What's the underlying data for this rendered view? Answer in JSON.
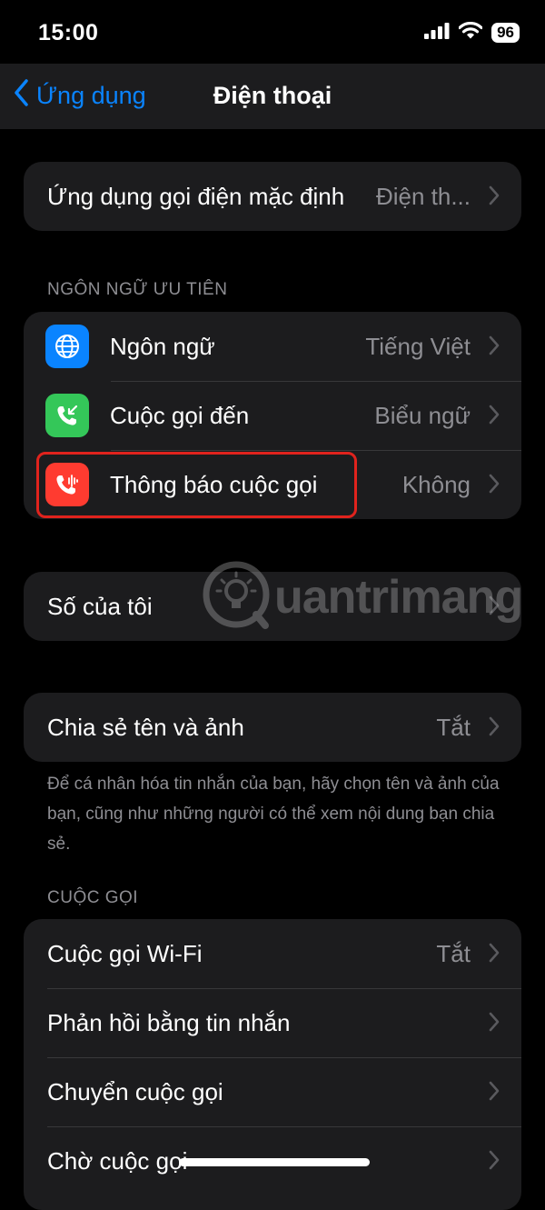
{
  "status_bar": {
    "time": "15:00",
    "battery": "96"
  },
  "nav": {
    "back_label": "Ứng dụng",
    "title": "Điện thoại"
  },
  "default_app": {
    "label": "Ứng dụng gọi điện mặc định",
    "value": "Điện th..."
  },
  "language_section": {
    "header": "NGÔN NGỮ ƯU TIÊN",
    "items": [
      {
        "label": "Ngôn ngữ",
        "value": "Tiếng Việt",
        "icon": "globe-icon",
        "color": "#0a84ff"
      },
      {
        "label": "Cuộc gọi đến",
        "value": "Biểu ngữ",
        "icon": "incoming-call-icon",
        "color": "#34c759"
      },
      {
        "label": "Thông báo cuộc gọi",
        "value": "Không",
        "icon": "announce-calls-icon",
        "color": "#ff3b30"
      }
    ]
  },
  "my_number": {
    "label": "Số của tôi"
  },
  "share": {
    "label": "Chia sẻ tên và ảnh",
    "value": "Tắt",
    "footer": "Để cá nhân hóa tin nhắn của bạn, hãy chọn tên và ảnh của bạn, cũng như những người có thể xem nội dung bạn chia sẻ."
  },
  "calls_section": {
    "header": "CUỘC GỌI",
    "items": [
      {
        "label": "Cuộc gọi Wi-Fi",
        "value": "Tắt"
      },
      {
        "label": "Phản hồi bằng tin nhắn",
        "value": ""
      },
      {
        "label": "Chuyển cuộc gọi",
        "value": ""
      },
      {
        "label": "Chờ cuộc gọi",
        "value": ""
      }
    ]
  },
  "watermark": {
    "text": "uantrimang"
  },
  "colors": {
    "accent": "#0a84ff",
    "highlight": "#e0231d",
    "cell_bg": "#1c1c1e"
  }
}
